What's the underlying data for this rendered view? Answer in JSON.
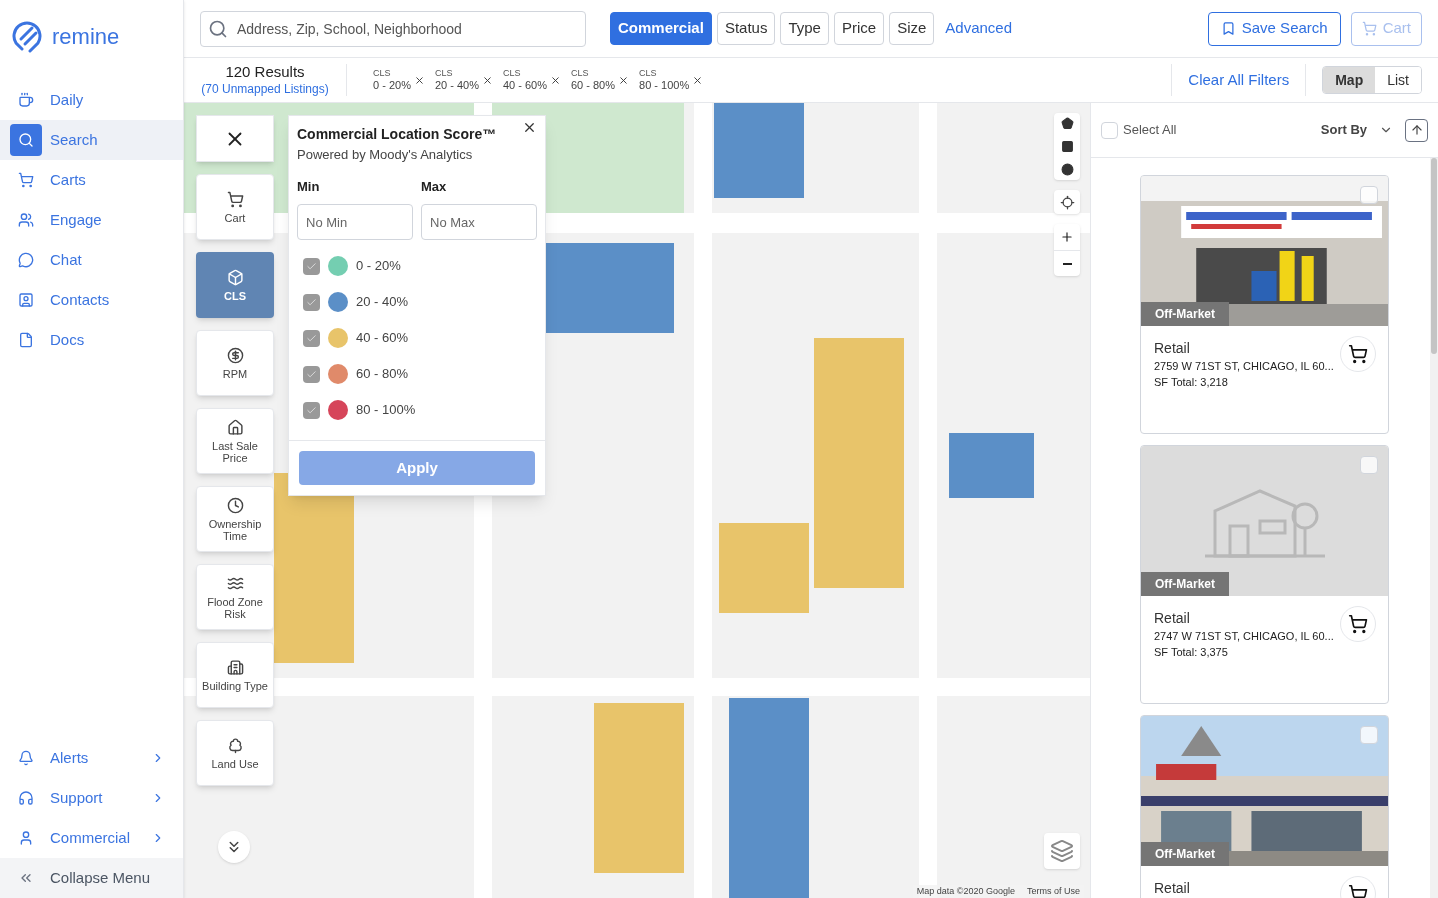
{
  "logo": {
    "text": "remine"
  },
  "sidebar": {
    "items": [
      {
        "label": "Daily",
        "selected": false
      },
      {
        "label": "Search",
        "selected": true
      },
      {
        "label": "Carts",
        "selected": false
      },
      {
        "label": "Engage",
        "selected": false
      },
      {
        "label": "Chat",
        "selected": false
      },
      {
        "label": "Contacts",
        "selected": false
      },
      {
        "label": "Docs",
        "selected": false
      }
    ],
    "bottom_items": [
      {
        "label": "Alerts"
      },
      {
        "label": "Support"
      },
      {
        "label": "Commercial"
      }
    ],
    "collapse": "Collapse Menu"
  },
  "search": {
    "placeholder": "Address, Zip, School, Neighborhood"
  },
  "filters": [
    {
      "label": "Commercial",
      "selected": true
    },
    {
      "label": "Status",
      "selected": false
    },
    {
      "label": "Type",
      "selected": false
    },
    {
      "label": "Price",
      "selected": false
    },
    {
      "label": "Size",
      "selected": false
    }
  ],
  "advanced": "Advanced",
  "actions": {
    "save_search": "Save Search",
    "cart": {
      "label": "Cart",
      "disabled": true
    }
  },
  "results": {
    "count": "120 Results",
    "unmapped": "(70 Unmapped Listings)"
  },
  "chips": [
    {
      "label": "CLS",
      "value": "0 - 20%"
    },
    {
      "label": "CLS",
      "value": "20 - 40%"
    },
    {
      "label": "CLS",
      "value": "40 - 60%"
    },
    {
      "label": "CLS",
      "value": "60 - 80%"
    },
    {
      "label": "CLS",
      "value": "80 - 100%"
    }
  ],
  "clear_filters": "Clear All Filters",
  "view_toggle": [
    {
      "label": "Map",
      "selected": true
    },
    {
      "label": "List",
      "selected": false
    }
  ],
  "map_tools": [
    {
      "label": "Cart",
      "selected": false
    },
    {
      "label": "CLS",
      "selected": true
    },
    {
      "label": "RPM",
      "selected": false
    },
    {
      "label": "Last Sale Price",
      "selected": false
    },
    {
      "label": "Ownership Time",
      "selected": false
    },
    {
      "label": "Flood Zone Risk",
      "selected": false
    },
    {
      "label": "Building Type",
      "selected": false
    },
    {
      "label": "Land Use",
      "selected": false
    }
  ],
  "popup": {
    "title": "Commercial Location Score™",
    "subtitle": "Powered by Moody's Analytics",
    "min": {
      "label": "Min",
      "placeholder": "No Min"
    },
    "max": {
      "label": "Max",
      "placeholder": "No Max"
    },
    "ranges": [
      {
        "label": "0 - 20%",
        "checked": true,
        "color": "#74ceb1"
      },
      {
        "label": "20 - 40%",
        "checked": true,
        "color": "#5b8fc7"
      },
      {
        "label": "40 - 60%",
        "checked": true,
        "color": "#e8c46a"
      },
      {
        "label": "60 - 80%",
        "checked": true,
        "color": "#e08a6a"
      },
      {
        "label": "80 - 100%",
        "checked": true,
        "color": "#d6455a"
      }
    ],
    "apply": "Apply"
  },
  "attribution": [
    "Map data ©2020 Google",
    "Terms of Use"
  ],
  "listings": {
    "select_all": {
      "label": "Select All",
      "checked": false
    },
    "sort": "Sort By",
    "cards": [
      {
        "status": "Off-Market",
        "type": "Retail",
        "address": "2759 W 71ST ST, CHICAGO, IL 60...",
        "sf": "SF Total: 3,218",
        "checked": false
      },
      {
        "kind": "placeholder",
        "status": "Off-Market",
        "type": "Retail",
        "address": "2747 W 71ST ST, CHICAGO, IL 60...",
        "sf": "SF Total: 3,375",
        "checked": false
      },
      {
        "kind": "photo2",
        "status": "Off-Market",
        "type": "Retail",
        "checked": false
      }
    ]
  }
}
